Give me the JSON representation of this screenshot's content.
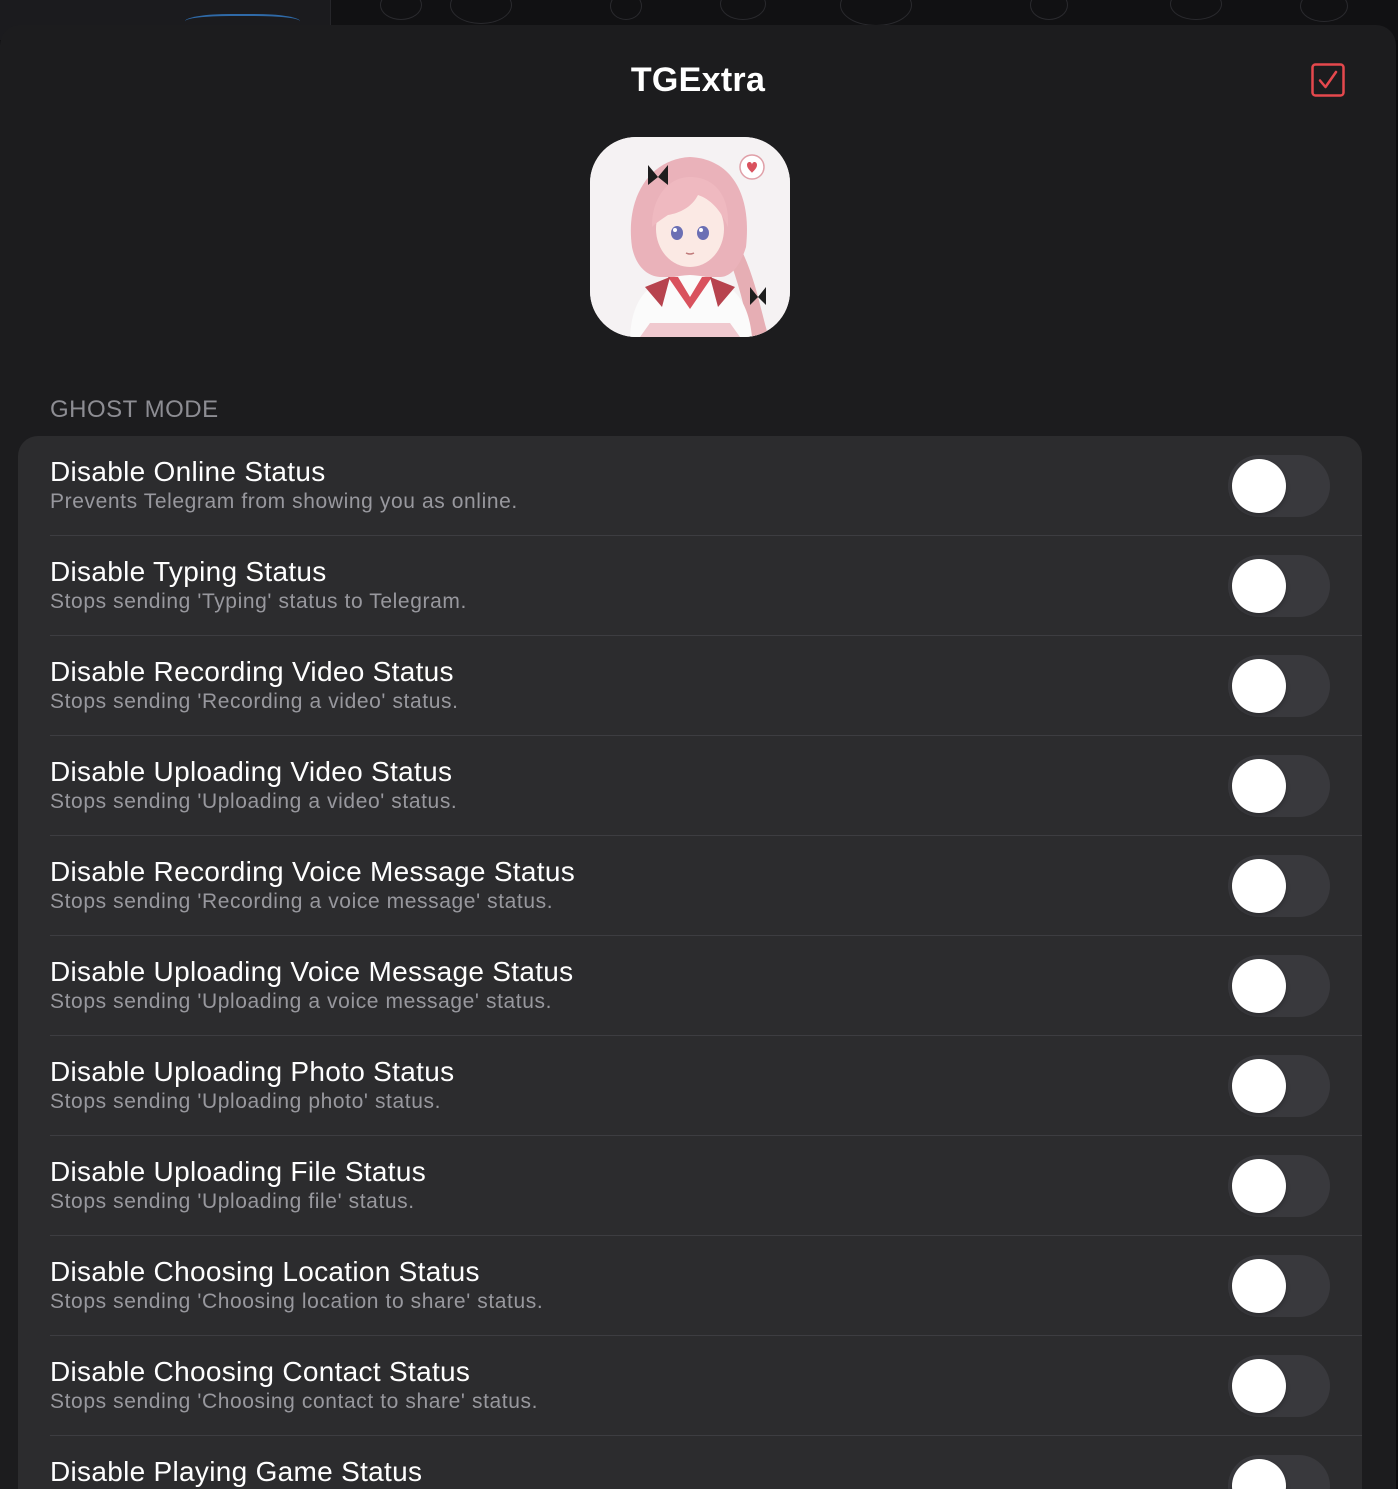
{
  "header": {
    "title": "TGExtra",
    "accent_color": "#e5484d"
  },
  "section": {
    "title": "GHOST MODE"
  },
  "settings": [
    {
      "label": "Disable Online Status",
      "description": "Prevents Telegram from showing you as online.",
      "enabled": false
    },
    {
      "label": "Disable Typing Status",
      "description": "Stops sending 'Typing' status to Telegram.",
      "enabled": false
    },
    {
      "label": "Disable Recording Video Status",
      "description": "Stops sending 'Recording a video' status.",
      "enabled": false
    },
    {
      "label": "Disable Uploading Video Status",
      "description": "Stops sending 'Uploading a video' status.",
      "enabled": false
    },
    {
      "label": "Disable Recording Voice Message Status",
      "description": "Stops sending 'Recording a voice message' status.",
      "enabled": false
    },
    {
      "label": "Disable Uploading Voice Message Status",
      "description": "Stops sending 'Uploading a voice message' status.",
      "enabled": false
    },
    {
      "label": "Disable Uploading Photo Status",
      "description": "Stops sending 'Uploading photo' status.",
      "enabled": false
    },
    {
      "label": "Disable Uploading File Status",
      "description": "Stops sending 'Uploading file' status.",
      "enabled": false
    },
    {
      "label": "Disable Choosing Location Status",
      "description": "Stops sending 'Choosing location to share' status.",
      "enabled": false
    },
    {
      "label": "Disable Choosing Contact Status",
      "description": "Stops sending 'Choosing contact to share' status.",
      "enabled": false
    },
    {
      "label": "Disable Playing Game Status",
      "description": "",
      "enabled": false
    }
  ],
  "colors": {
    "sheet_background": "#1c1c1e",
    "group_background": "#2c2c2e",
    "toggle_off": "#39393d",
    "toggle_on": "#34c759"
  }
}
